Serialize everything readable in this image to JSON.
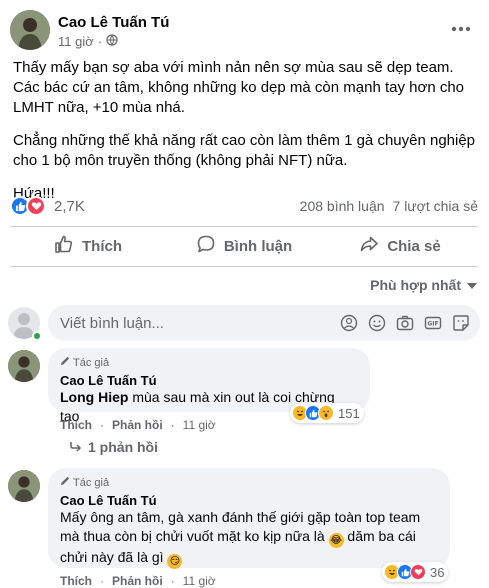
{
  "post": {
    "author": "Cao Lê Tuấn Tú",
    "time": "11 giờ",
    "privacy_icon": "globe-icon",
    "paragraphs": [
      "Thấy mấy bạn sợ aba với mình nản nên sợ mùa sau sẽ dẹp team. Các bác cứ an tâm, không những ko dẹp mà còn mạnh tay hơn cho LMHT nữa, +10 mùa nhá.",
      "Chẳng những thế khả năng rất cao còn làm thêm 1 gà chuyên nghiệp cho 1 bộ môn truyền thống (không phải NFT) nữa.",
      "Hứa!!!"
    ],
    "reaction_count": "2,7K",
    "comments_count": "208 bình luận",
    "shares_count": "7 lượt chia sẻ"
  },
  "actions": {
    "like": "Thích",
    "comment": "Bình luận",
    "share": "Chia sẻ"
  },
  "sort_label": "Phù hợp nhất",
  "comment_input": {
    "placeholder": "Viết bình luận..."
  },
  "comments": [
    {
      "badge": "Tác giả",
      "author": "Cao Lê Tuấn Tú",
      "mention": "Long Hiep",
      "text": " mùa sau mà xin out là coi chừng tao",
      "reaction_count": "151",
      "like_label": "Thích",
      "reply_label": "Phản hồi",
      "time": "11 giờ",
      "replies": "1 phản hồi"
    },
    {
      "badge": "Tác giả",
      "author": "Cao Lê Tuấn Tú",
      "text_line1": "Mấy ông an tâm, gà xanh đánh thế giới gặp toàn top team",
      "text_line2a": "mà thua còn bị chửi vuốt mặt ko kịp nữa là ",
      "text_line2b": " dăm ba cái",
      "text_line3": "chửi này đã là gì ",
      "reaction_count": "36",
      "like_label": "Thích",
      "reply_label": "Phản hồi",
      "time": "11 giờ"
    }
  ],
  "colors": {
    "like_blue": "#1877f2",
    "love_red": "#f33e58",
    "haha_yellow": "#f7b928",
    "muted_text": "#65676b",
    "bubble_bg": "#f0f2f5"
  }
}
